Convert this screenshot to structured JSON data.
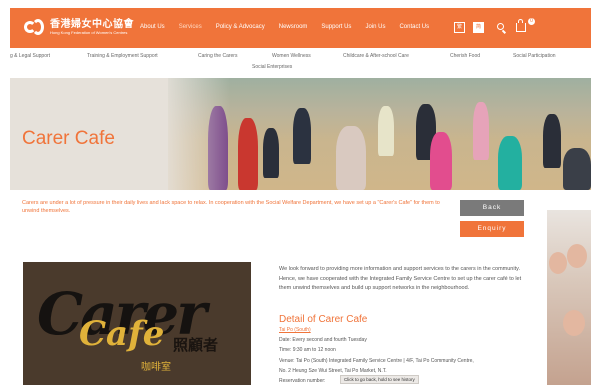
{
  "brand": {
    "name_zh": "香港婦女中心協會",
    "name_en": "Hong Kong Federation of Women's Centres"
  },
  "nav": {
    "items": [
      "About Us",
      "Services",
      "Policy & Advocacy",
      "Newsroom",
      "Support Us",
      "Join Us",
      "Contact Us"
    ],
    "lang_trad": "繁",
    "lang_simp": "简",
    "cart_count": "0"
  },
  "subnav": {
    "items": [
      "g & Legal Support",
      "Training & Employment Support",
      "Caring the Carers",
      "Women Wellness",
      "Childcare & After-school Care",
      "Cherish Food",
      "Social Participation"
    ],
    "second_row": "Social Enterprises"
  },
  "hero": {
    "title": "Carer Cafe"
  },
  "intro": {
    "text": "Carers are under a lot of pressure in their daily lives and lack space to relax. In cooperation with the Social Welfare Department, we have set up a \"Carer's Cafe\" for them to unwind themselves."
  },
  "buttons": {
    "back": "Back",
    "enquiry": "Enquiry"
  },
  "card": {
    "script_line1": "Carer",
    "script_line2": "Cafe",
    "zh_main": "照顧者",
    "zh_sub": "咖啡室"
  },
  "body": {
    "paragraph": "We look forward to providing more information and support services to the carers in the community. Hence, we have cooperated with the Integrated Family Service Centre to set up the carer café to let them unwind themselves and build up support networks in the neighbourhood."
  },
  "detail": {
    "title": "Detail of Carer Cafe",
    "location": "Tai Po (South)",
    "date": "Date: Every second and fourth Tuesday",
    "time": "Time: 9:30 am to 12 noon",
    "venue": "Venue: Tai Po (South) Integrated Family Service Centre | 4/F, Tai Po Community Centre,",
    "address": "No. 2 Heung Sze Wui Street, Tai Po Market, N.T.",
    "reservation": "Reservation number:"
  },
  "tooltip": "Click to go back, hold to see history",
  "colors": {
    "accent": "#f0743a",
    "back_button": "#7a7a7a"
  }
}
